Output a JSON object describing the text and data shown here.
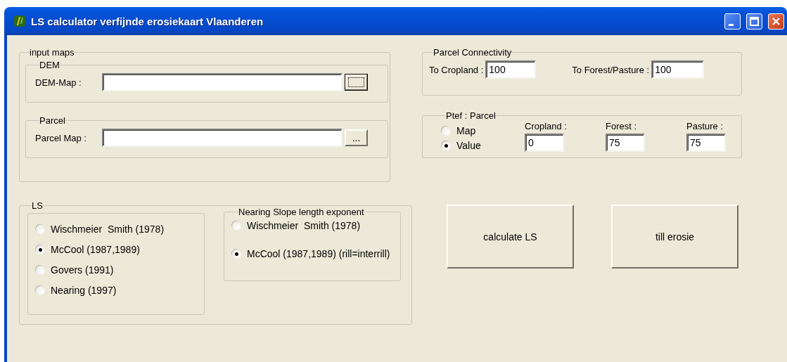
{
  "window": {
    "title": "LS calculator verfijnde erosiekaart Vlaanderen",
    "controls": [
      {
        "kind": "minimize"
      },
      {
        "kind": "maximize"
      },
      {
        "kind": "close"
      }
    ]
  },
  "input_maps": {
    "legend": "input maps",
    "groups": [
      {
        "legend": "DEM",
        "label": "DEM-Map :",
        "browse": {
          "focused": true
        }
      },
      {
        "legend": "Parcel",
        "label": "Parcel Map :",
        "browse": {
          "label": "...",
          "focused": false
        }
      }
    ]
  },
  "parcel_connectivity": {
    "legend": "Parcel Connectivity",
    "fields": [
      {
        "label": "To Cropland :",
        "value": "100"
      },
      {
        "label": "To Forest/Pasture :",
        "value": "100"
      }
    ]
  },
  "ptef": {
    "legend": "Ptef : Parcel",
    "options": [
      {
        "label": "Map",
        "selected": false
      },
      {
        "label": "Value",
        "selected": true
      }
    ],
    "fields": [
      {
        "label": "Cropland :",
        "value": "0"
      },
      {
        "label": "Forest :",
        "value": "75"
      },
      {
        "label": "Pasture :",
        "value": "75"
      }
    ]
  },
  "ls": {
    "legend": "LS",
    "methods": [
      {
        "label": "Wischmeier  Smith (1978)",
        "selected": false
      },
      {
        "label": "McCool (1987,1989)",
        "selected": true
      },
      {
        "label": "Govers (1991)",
        "selected": false
      },
      {
        "label": "Nearing (1997)",
        "selected": false
      }
    ],
    "nearing": {
      "legend": "Nearing Slope length exponent",
      "options": [
        {
          "label": "Wischmeier  Smith (1978)",
          "selected": false
        },
        {
          "label": "McCool (1987,1989) (rill=interrill)",
          "selected": true
        }
      ]
    }
  },
  "buttons": [
    {
      "label": "calculate LS"
    },
    {
      "label": "till erosie"
    }
  ]
}
